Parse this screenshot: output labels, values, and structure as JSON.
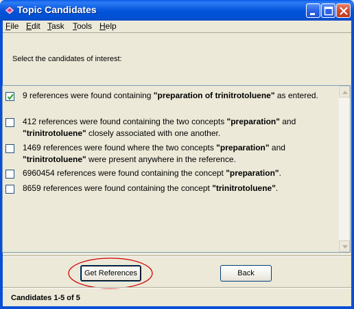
{
  "window": {
    "title": "Topic Candidates",
    "title_icon": "app-icon",
    "controls": [
      "minimize-icon",
      "maximize-icon",
      "close-icon"
    ]
  },
  "menu": {
    "items": [
      {
        "label": "File"
      },
      {
        "label": "Edit"
      },
      {
        "label": "Task"
      },
      {
        "label": "Tools"
      },
      {
        "label": "Help"
      }
    ]
  },
  "instruction": "Select the candidates of interest:",
  "candidates": [
    {
      "checked": true,
      "parts": [
        "9 references were found containing ",
        "\"preparation of trinitrotoluene\"",
        " as entered."
      ]
    },
    {
      "checked": false,
      "parts": [
        "412 references were found containing the two concepts ",
        "\"preparation\"",
        " and ",
        "\"trinitrotoluene\"",
        " closely associated with one another."
      ]
    },
    {
      "checked": false,
      "parts": [
        "1469 references were found where the two concepts ",
        "\"preparation\"",
        " and ",
        "\"trinitrotoluene\"",
        " were present anywhere in the reference."
      ]
    },
    {
      "checked": false,
      "parts": [
        "6960454 references were found containing the concept ",
        "\"preparation\"",
        "."
      ]
    },
    {
      "checked": false,
      "parts": [
        "8659 references were found containing the concept ",
        "\"trinitrotoluene\"",
        "."
      ]
    }
  ],
  "buttons": {
    "get_references": "Get References",
    "back": "Back"
  },
  "status": "Candidates 1-5 of 5",
  "colors": {
    "titlebar": "#0a5ae0",
    "window_bg": "#ece9d8",
    "highlight_ellipse": "#d10000"
  }
}
